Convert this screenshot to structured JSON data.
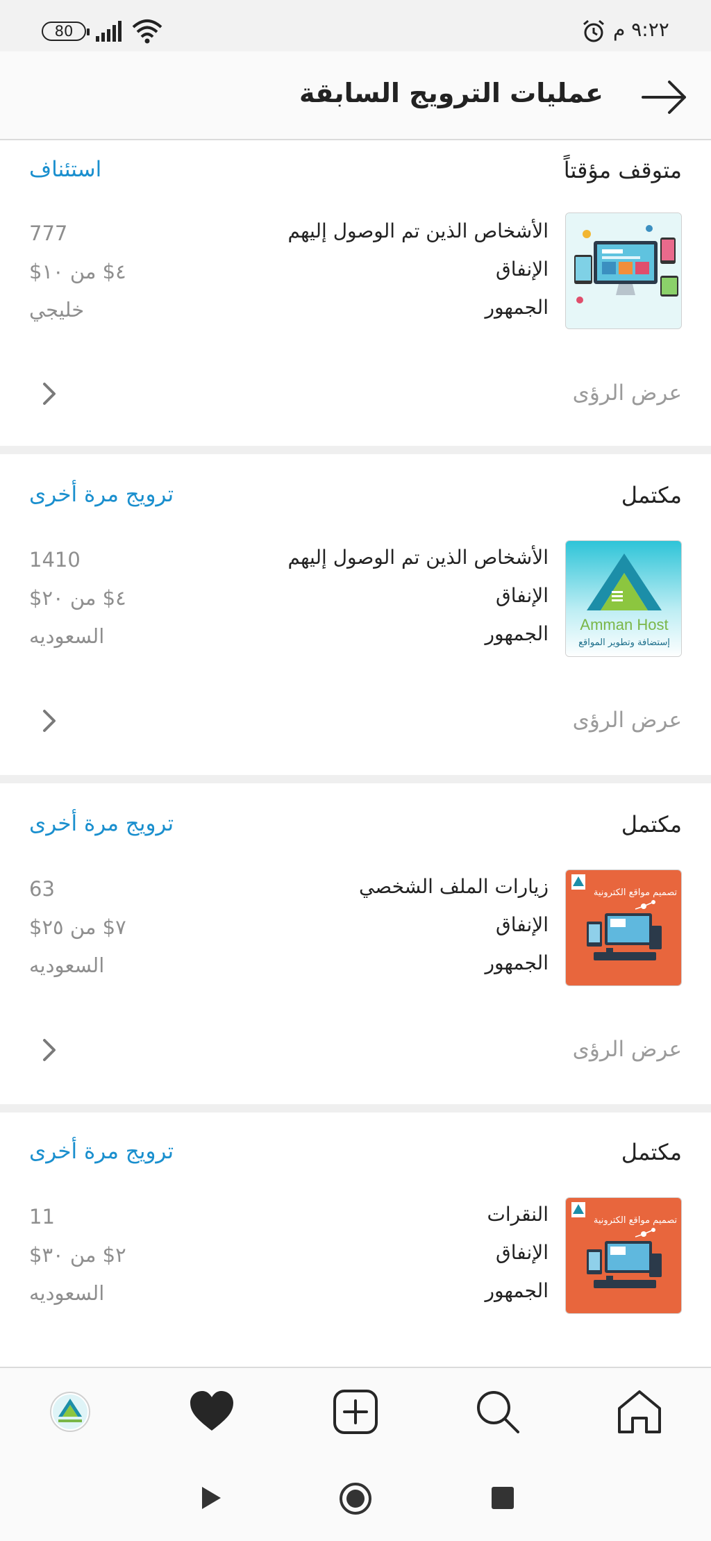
{
  "status_bar": {
    "time": "٩:٢٢ م",
    "battery": "80"
  },
  "header": {
    "title": "عمليات الترويج السابقة"
  },
  "promotions": [
    {
      "status": "متوقف مؤقتاً",
      "action": "استئناف",
      "metrics": [
        {
          "label": "الأشخاص الذين تم الوصول إليهم",
          "value": "777"
        },
        {
          "label": "الإنفاق",
          "value": "٤$ من ١٠$"
        },
        {
          "label": "الجمهور",
          "value": "خليجي"
        }
      ],
      "insights": "عرض الرؤى",
      "thumbnail": "web-devices-image"
    },
    {
      "status": "مكتمل",
      "action": "ترويج مرة أخرى",
      "metrics": [
        {
          "label": "الأشخاص الذين تم الوصول إليهم",
          "value": "1410"
        },
        {
          "label": "الإنفاق",
          "value": "٤$ من ٢٠$"
        },
        {
          "label": "الجمهور",
          "value": "السعوديه"
        }
      ],
      "insights": "عرض الرؤى",
      "thumbnail": "amman-host-logo",
      "thumbnail_text": {
        "brand": "Amman Host",
        "tagline": "إستضافة وتطوير المواقع"
      }
    },
    {
      "status": "مكتمل",
      "action": "ترويج مرة أخرى",
      "metrics": [
        {
          "label": "زيارات الملف الشخصي",
          "value": "63"
        },
        {
          "label": "الإنفاق",
          "value": "٧$ من ٢٥$"
        },
        {
          "label": "الجمهور",
          "value": "السعوديه"
        }
      ],
      "insights": "عرض الرؤى",
      "thumbnail": "web-design-orange-image",
      "thumbnail_text": {
        "caption": "تصميم مواقع الكترونية"
      }
    },
    {
      "status": "مكتمل",
      "action": "ترويج مرة أخرى",
      "metrics": [
        {
          "label": "النقرات",
          "value": "11"
        },
        {
          "label": "الإنفاق",
          "value": "٢$ من ٣٠$"
        },
        {
          "label": "الجمهور",
          "value": "السعوديه"
        }
      ],
      "insights": "عرض الرؤى",
      "thumbnail": "web-design-orange-image",
      "thumbnail_text": {
        "caption": "تصميم مواقع الكترونية"
      }
    }
  ],
  "bottom_nav": [
    "profile-avatar",
    "heart-icon",
    "add-post-icon",
    "search-icon",
    "home-icon"
  ],
  "colors": {
    "link": "#1a8fce",
    "muted": "#8e8e8e",
    "orange_thumb": "#e8663d"
  }
}
